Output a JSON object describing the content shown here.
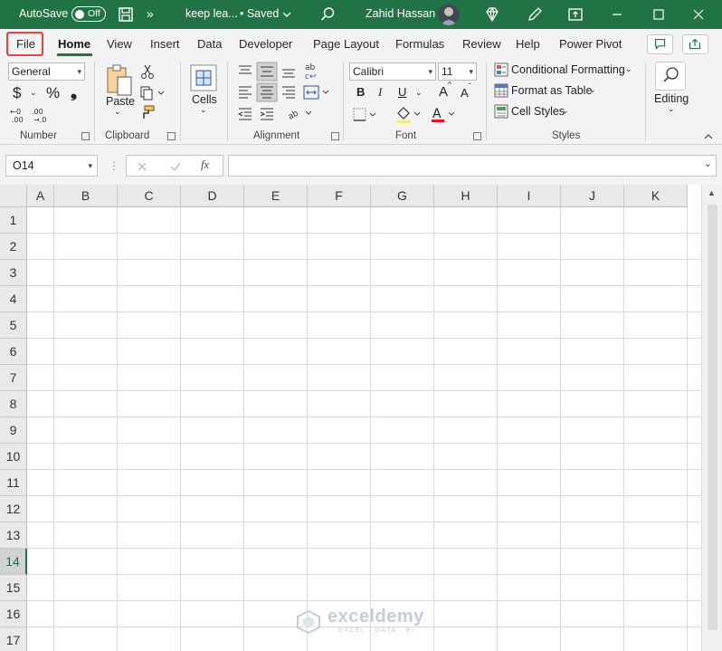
{
  "titlebar": {
    "autosave_label": "AutoSave",
    "autosave_state": "Off",
    "file_title": "keep lea...",
    "saved_status": "• Saved",
    "user_name": "Zahid Hassan",
    "more_chevrons": "»"
  },
  "tabs": [
    "File",
    "Home",
    "View",
    "Insert",
    "Data",
    "Developer",
    "Page Layout",
    "Formulas",
    "Review",
    "Help",
    "Power Pivot"
  ],
  "active_tab": "Home",
  "ribbon": {
    "number": {
      "format_value": "General",
      "currency": "$",
      "percent": "%",
      "comma": "❟",
      "group_label": "Number"
    },
    "clipboard": {
      "paste_label": "Paste",
      "group_label": "Clipboard"
    },
    "cells": {
      "label": "Cells"
    },
    "alignment": {
      "group_label": "Alignment"
    },
    "font": {
      "font_name": "Calibri",
      "font_size": "11",
      "bold": "B",
      "italic": "I",
      "underline": "U",
      "grow": "A",
      "shrink": "A",
      "group_label": "Font"
    },
    "styles": {
      "conditional_formatting": "Conditional Formatting",
      "format_as_table": "Format as Table",
      "cell_styles": "Cell Styles",
      "group_label": "Styles"
    },
    "editing": {
      "label": "Editing"
    }
  },
  "formula_bar": {
    "name_box": "O14",
    "fx": "fx",
    "formula": ""
  },
  "grid": {
    "columns": [
      "A",
      "B",
      "C",
      "D",
      "E",
      "F",
      "G",
      "H",
      "I",
      "J",
      "K"
    ],
    "rows": [
      "1",
      "2",
      "3",
      "4",
      "5",
      "6",
      "7",
      "8",
      "9",
      "10",
      "11",
      "12",
      "13",
      "14",
      "15",
      "16",
      "17"
    ],
    "selected_row": "14"
  },
  "watermark": {
    "brand": "exceldemy",
    "tagline": "EXCEL · DATA · BI"
  },
  "colors": {
    "excel_green": "#217346",
    "file_highlight": "#e04444",
    "font_color_bar": "#e81123"
  }
}
